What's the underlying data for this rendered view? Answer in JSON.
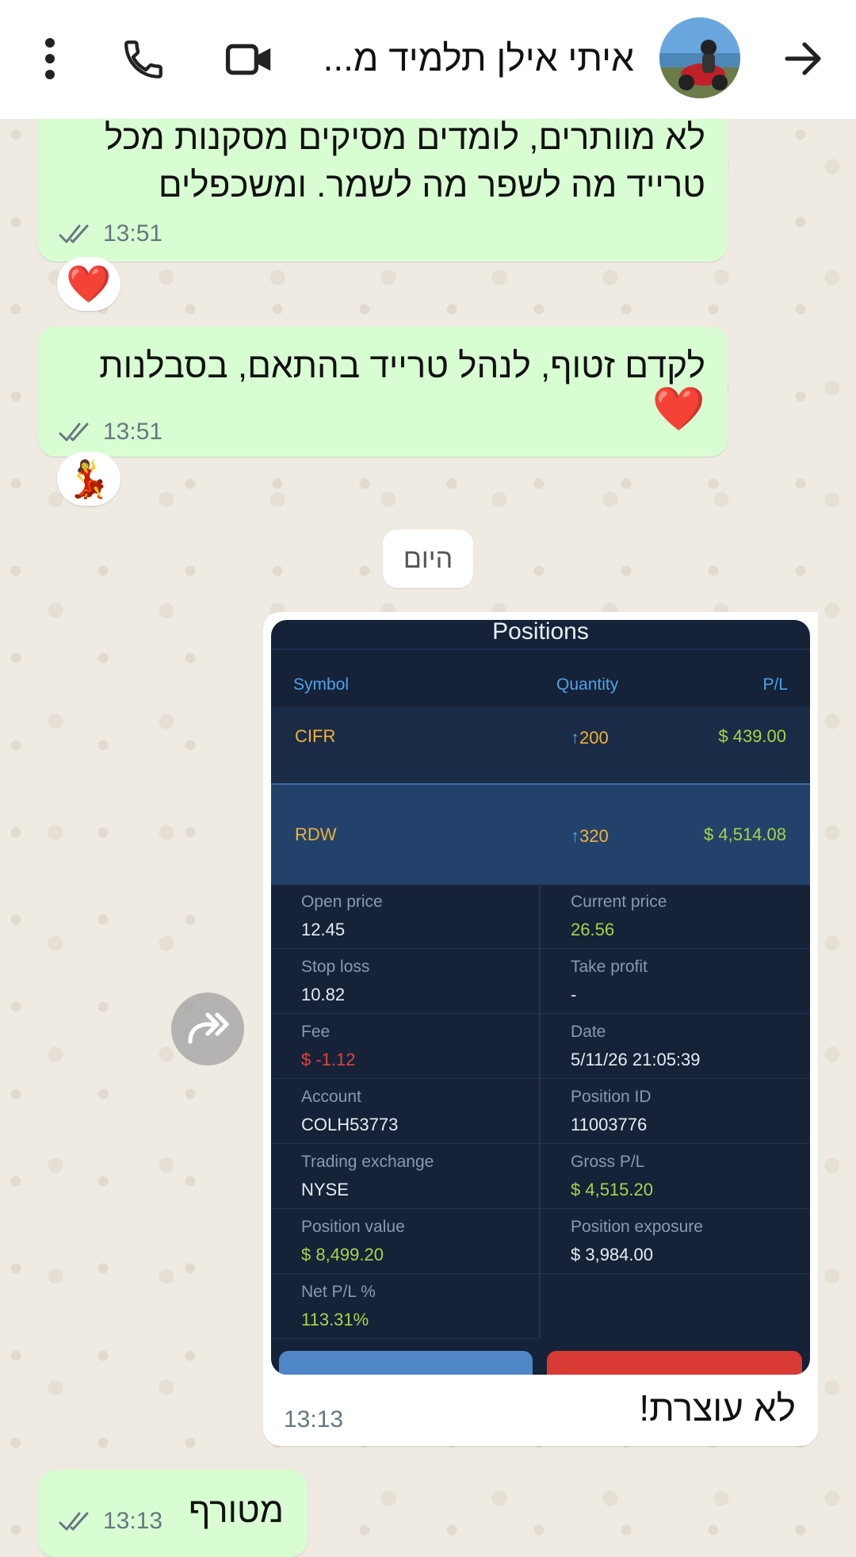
{
  "header": {
    "contact_name": "איתי אילן תלמיד מ...",
    "back_icon": "arrow-right-icon",
    "call_icon": "phone-icon",
    "video_icon": "video-camera-icon",
    "menu_icon": "more-vertical-icon"
  },
  "messages": [
    {
      "text_lines": [
        "לא מוותרים, לומדים מסיקים מסקנות מכל",
        "טרייד מה לשפר מה לשמר. ומשכפלים"
      ],
      "time": "13:51",
      "reaction": "❤️"
    },
    {
      "text_lines": [
        "לקדם זטוף, לנהל טרייד בהתאם, בסבלנות",
        "❤️"
      ],
      "time": "13:51",
      "reaction": "💃"
    }
  ],
  "date_separator": "היום",
  "incoming": {
    "caption": "לא עוצרת!",
    "time": "13:13",
    "screenshot": {
      "title": "Positions",
      "headers": {
        "symbol": "Symbol",
        "quantity": "Quantity",
        "pl": "P/L"
      },
      "positions": [
        {
          "symbol": "CIFR",
          "arrow": "↑",
          "quantity": "200",
          "pl": "$ 439.00"
        },
        {
          "symbol": "RDW",
          "arrow": "↑",
          "quantity": "320",
          "pl": "$ 4,514.08"
        }
      ],
      "details": [
        {
          "label": "Open price",
          "value": "12.45"
        },
        {
          "label": "Current price",
          "value": "26.56"
        },
        {
          "label": "Stop loss",
          "value": "10.82"
        },
        {
          "label": "Take profit",
          "value": "-"
        },
        {
          "label": "Fee",
          "value": "$ -1.12"
        },
        {
          "label": "Date",
          "value": "5/11/26 21:05:39"
        },
        {
          "label": "Account",
          "value": "COLH53773"
        },
        {
          "label": "Position ID",
          "value": "11003776"
        },
        {
          "label": "Trading exchange",
          "value": "NYSE"
        },
        {
          "label": "Gross P/L",
          "value": "$ 4,515.20"
        },
        {
          "label": "Position value",
          "value": "$ 8,499.20"
        },
        {
          "label": "Position exposure",
          "value": "$ 3,984.00"
        },
        {
          "label": "Net P/L %",
          "value": "113.31%"
        }
      ]
    }
  },
  "last_message": {
    "text": "מטורף",
    "time": "13:13"
  },
  "colors": {
    "outgoing": "#d9fdd3",
    "incoming": "#ffffff",
    "wallpaper": "#efeae2"
  }
}
